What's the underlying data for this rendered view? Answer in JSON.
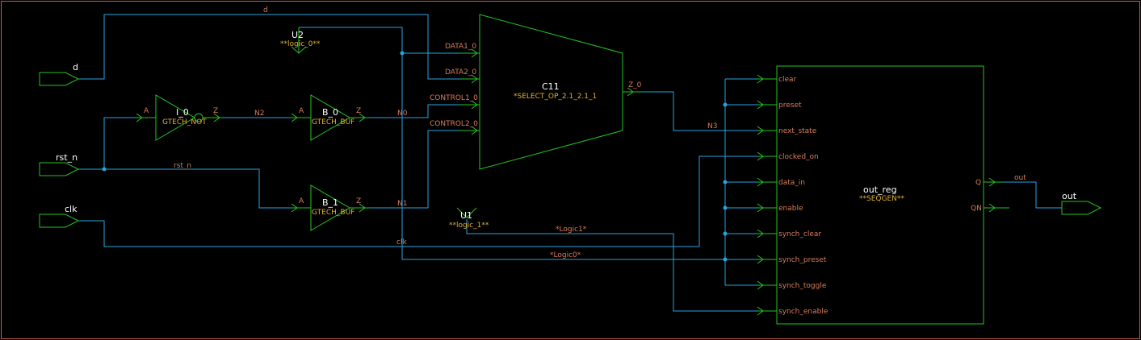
{
  "colors": {
    "wire": "#29a3e0",
    "symbol": "#23c423",
    "pin_label": "#d97c5a",
    "ref_label": "#e0b030",
    "name_label": "#ffffff",
    "border": "#c0604a"
  },
  "ports": {
    "d": "d",
    "rst_n": "rst_n",
    "clk": "clk",
    "out": "out"
  },
  "nets": {
    "d": "d",
    "rst_n": "rst_n",
    "clk": "clk",
    "n2": "N2",
    "n0": "N0",
    "n1": "N1",
    "n3": "N3",
    "z0": "Z_0",
    "out": "out",
    "logic1": "*Logic1*",
    "logic0": "*Logic0*"
  },
  "cells": {
    "u2": {
      "name": "U2",
      "ref": "**logic_0**"
    },
    "u1": {
      "name": "U1",
      "ref": "**logic_1**"
    },
    "i0": {
      "name": "I_0",
      "ref": "GTECH_NOT",
      "pin_in": "A",
      "pin_out": "Z"
    },
    "b0": {
      "name": "B_0",
      "ref": "GTECH_BUF",
      "pin_in": "A",
      "pin_out": "Z"
    },
    "b1": {
      "name": "B_1",
      "ref": "GTECH_BUF",
      "pin_in": "A",
      "pin_out": "Z"
    },
    "c11": {
      "name": "C11",
      "ref": "*SELECT_OP_2.1_2.1_1",
      "pins": [
        "DATA1_0",
        "DATA2_0",
        "CONTROL1_0",
        "CONTROL2_0"
      ],
      "pin_out": "Z_0"
    },
    "out_reg": {
      "name": "out_reg",
      "ref": "**SEQGEN**",
      "pins": [
        "clear",
        "preset",
        "next_state",
        "clocked_on",
        "data_in",
        "enable",
        "synch_clear",
        "synch_preset",
        "synch_toggle",
        "synch_enable"
      ],
      "out_pins": [
        "Q",
        "QN"
      ]
    }
  }
}
